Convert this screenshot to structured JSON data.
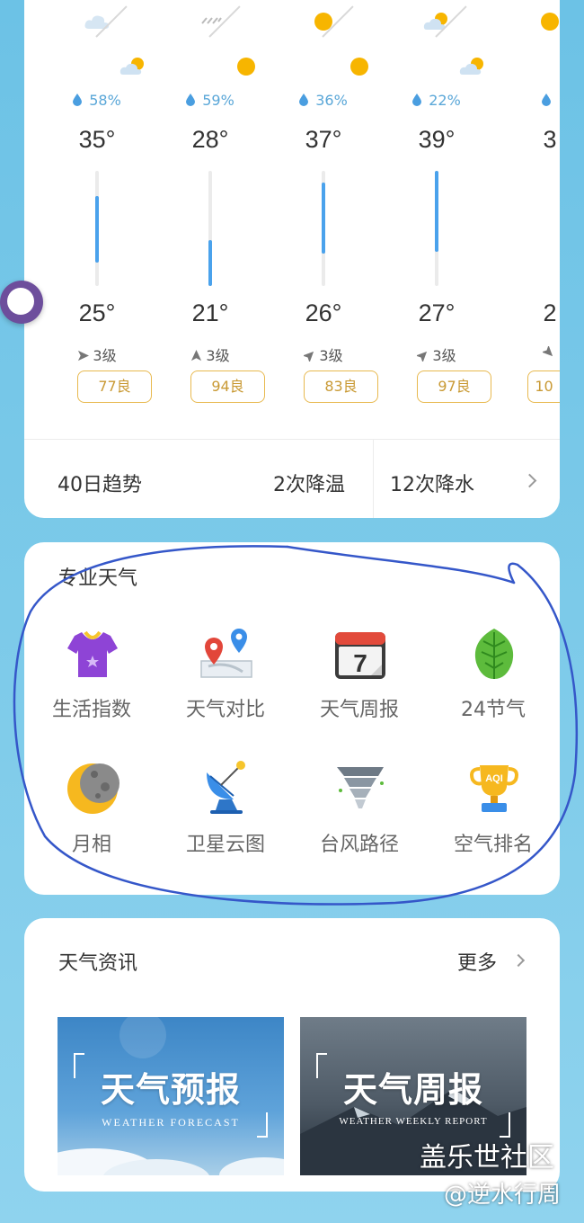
{
  "forecast": {
    "days": [
      {
        "top_icon": "cloudy-icon",
        "bottom_icon": "partly-cloudy-icon",
        "precip": "58%",
        "high": "35°",
        "low": "25°",
        "wind": "3级",
        "aqi": "77良",
        "range": [
          0.22,
          0.8
        ]
      },
      {
        "top_icon": "rain-icon",
        "bottom_icon": "sunny-icon",
        "precip": "59%",
        "high": "28°",
        "low": "21°",
        "wind": "3级",
        "aqi": "94良",
        "range": [
          0.6,
          1.0
        ]
      },
      {
        "top_icon": "sunny-icon",
        "bottom_icon": "sunny-icon",
        "precip": "36%",
        "high": "37°",
        "low": "26°",
        "wind": "3级",
        "aqi": "83良",
        "range": [
          0.1,
          0.72
        ]
      },
      {
        "top_icon": "partly-cloudy-icon",
        "bottom_icon": "partly-cloudy-icon",
        "precip": "22%",
        "high": "39°",
        "low": "27°",
        "wind": "3级",
        "aqi": "97良",
        "range": [
          0.0,
          0.7
        ]
      },
      {
        "top_icon": "sunny-icon",
        "bottom_icon": "",
        "precip": "",
        "high": "3",
        "low": "2",
        "wind": "",
        "aqi": "10",
        "range": [
          0,
          0
        ]
      }
    ],
    "trend": {
      "label": "40日趋势",
      "cooling": "2次降温",
      "rain": "12次降水"
    }
  },
  "pro": {
    "title": "专业天气",
    "items": [
      {
        "name": "life-index",
        "label": "生活指数"
      },
      {
        "name": "weather-compare",
        "label": "天气对比"
      },
      {
        "name": "weekly-report",
        "label": "天气周报",
        "calendar_day": "7"
      },
      {
        "name": "solar-terms",
        "label": "24节气"
      },
      {
        "name": "moon-phase",
        "label": "月相"
      },
      {
        "name": "satellite",
        "label": "卫星云图"
      },
      {
        "name": "typhoon",
        "label": "台风路径"
      },
      {
        "name": "air-rank",
        "label": "空气排名",
        "badge": "AQI"
      }
    ]
  },
  "news": {
    "title": "天气资讯",
    "more": "更多",
    "cards": [
      {
        "title": "天气预报",
        "subtitle": "WEATHER FORECAST"
      },
      {
        "title": "天气周报",
        "subtitle": "WEATHER WEEKLY REPORT"
      }
    ]
  },
  "watermark": {
    "site": "盖乐世社区",
    "user": "@逆水行周"
  },
  "colors": {
    "accent": "#4aa2ec",
    "aqi_good": "#e8b94f",
    "sun": "#f7b500",
    "annotation": "#3557c9"
  }
}
